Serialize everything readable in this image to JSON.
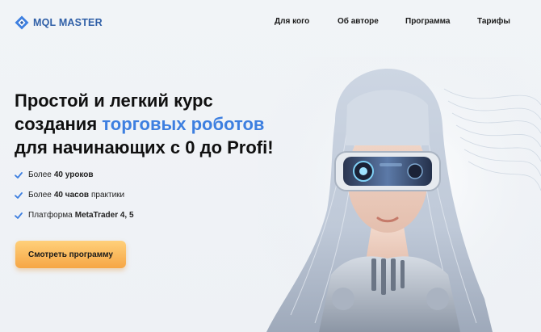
{
  "brand": {
    "name": "MQL MASTER",
    "accent_color": "#3d7fe0",
    "logo_color": "#2f5fa7"
  },
  "nav": {
    "items": [
      {
        "label": "Для кого"
      },
      {
        "label": "Об авторе"
      },
      {
        "label": "Программа"
      },
      {
        "label": "Тарифы"
      }
    ]
  },
  "hero": {
    "title_line1": "Простой и легкий курс",
    "title_line2_start": "создания ",
    "title_line2_accent": "торговых роботов",
    "title_line3": "для начинающих с 0 до Profi!",
    "features": [
      {
        "prefix": "Более",
        "bold": "40 уроков",
        "suffix": ""
      },
      {
        "prefix": "Более",
        "bold": "40 часов",
        "suffix": "практики"
      },
      {
        "prefix": "Платформа",
        "bold": "MetaTrader 4, 5",
        "suffix": ""
      }
    ],
    "cta_label": "Смотреть программу",
    "cta_color": "#f6a645"
  },
  "icons": {
    "logo": "diamond-logo-icon",
    "feature_bullet": "check-icon"
  }
}
